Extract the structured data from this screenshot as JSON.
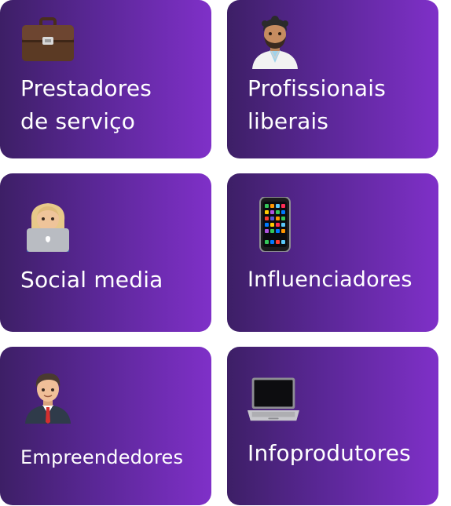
{
  "cards": [
    {
      "label": "Prestadores\nde serviço",
      "icon": "briefcase-icon"
    },
    {
      "label": "Profissionais\nliberais",
      "icon": "health-worker-icon"
    },
    {
      "label": "Social media",
      "icon": "person-laptop-icon"
    },
    {
      "label": "Influenciadores",
      "icon": "smartphone-icon"
    },
    {
      "label": "Empreendedores",
      "icon": "businessman-icon"
    },
    {
      "label": "Infoprodutores",
      "icon": "laptop-icon"
    }
  ],
  "colors": {
    "gradient_start": "#3d1f66",
    "gradient_mid": "#5a2796",
    "gradient_end": "#7f30c8",
    "text": "#ffffff"
  }
}
